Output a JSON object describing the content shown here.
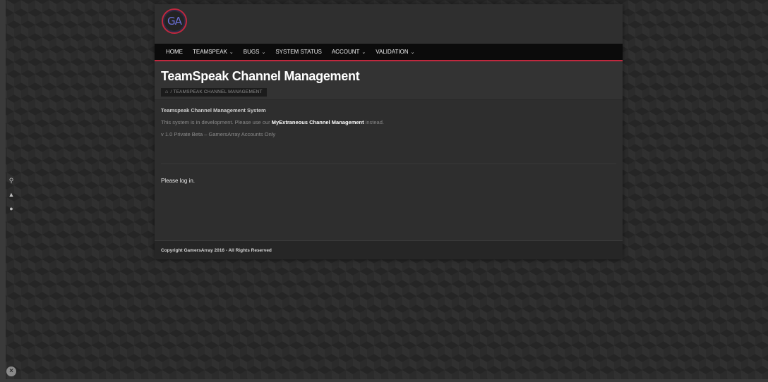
{
  "side_icons": {
    "search_glyph": "⚲",
    "bell_glyph": "▲",
    "user_glyph": "●",
    "close_glyph": "×"
  },
  "header": {
    "logo_text": "GA"
  },
  "nav": {
    "items": [
      {
        "label": "HOME",
        "dropdown": false
      },
      {
        "label": "TEAMSPEAK",
        "dropdown": true
      },
      {
        "label": "BUGS",
        "dropdown": true
      },
      {
        "label": "SYSTEM STATUS",
        "dropdown": false
      },
      {
        "label": "ACCOUNT",
        "dropdown": true
      },
      {
        "label": "VALIDATION",
        "dropdown": true
      }
    ],
    "chevron": "⌄"
  },
  "page": {
    "title": "TeamSpeak Channel Management",
    "breadcrumb_home_glyph": "⌂",
    "breadcrumb_text": "/ TEAMSPEAK CHANNEL MANAGEMENT"
  },
  "content": {
    "heading": "Teamspeak Channel Management System",
    "body_prefix": "This system is in development. Please use our ",
    "body_link": "MyExtraneous Channel Management",
    "body_suffix": " instead.",
    "version": "v 1.0 Private Beta – GamersArray Accounts Only",
    "login_prompt": "Please log in."
  },
  "footer": {
    "copyright": "Copyright GamersArray 2016 - All Rights Reserved"
  },
  "colors": {
    "accent": "#c0283e",
    "nav_bg": "#0b0b0b",
    "page_bg": "#2b2b2b"
  }
}
